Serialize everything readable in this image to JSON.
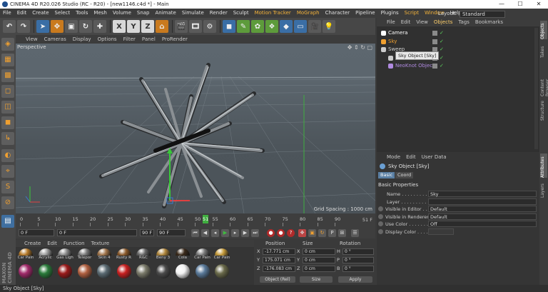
{
  "window": {
    "title": "CINEMA 4D R20.026 Studio (RC - R20) - [new1146.c4d *] - Main",
    "min": "—",
    "max": "☐",
    "close": "✕"
  },
  "menu": [
    "File",
    "Edit",
    "Create",
    "Select",
    "Tools",
    "Mesh",
    "Volume",
    "Snap",
    "Animate",
    "Simulate",
    "Render",
    "Sculpt",
    "Motion Tracker",
    "MoGraph",
    "Character",
    "Pipeline",
    "Plugins",
    "Script",
    "Window",
    "Help"
  ],
  "menu_highlight": [
    "Motion Tracker",
    "MoGraph",
    "Script",
    "Window"
  ],
  "layout": {
    "label": "Layout:",
    "value": "Standard"
  },
  "toolbar_axes": [
    "X",
    "Y",
    "Z"
  ],
  "viewport": {
    "menu": [
      "View",
      "Cameras",
      "Display",
      "Options",
      "Filter",
      "Panel",
      "ProRender"
    ],
    "label": "Perspective",
    "grid_spacing": "Grid Spacing : 1000 cm"
  },
  "timeline": {
    "ticks": [
      "0",
      "5",
      "10",
      "15",
      "20",
      "25",
      "30",
      "35",
      "40",
      "45",
      "50",
      "55",
      "60",
      "65",
      "70",
      "75",
      "80",
      "85",
      "90"
    ],
    "current_frame": "51",
    "end_label": "51 F",
    "start_field": "0 F",
    "min_field": "0 F",
    "max_field": "90 F",
    "end_field": "90 F"
  },
  "materials": {
    "menu": [
      "Create",
      "Edit",
      "Function",
      "Texture"
    ],
    "row1": [
      {
        "label": "Car Pain",
        "color": "#b57a2a"
      },
      {
        "label": "Acrylic",
        "color": "#9a9a9a"
      },
      {
        "label": "Gas Ligh",
        "color": "#8a8a8a"
      },
      {
        "label": "Telepor",
        "color": "#7a7a7a"
      },
      {
        "label": "Skin 4",
        "color": "#a0744a"
      },
      {
        "label": "Rusty R",
        "color": "#8b5a2b"
      },
      {
        "label": "R&C",
        "color": "#666666"
      },
      {
        "label": "Beny 3",
        "color": "#b0873d"
      },
      {
        "label": "Cola",
        "color": "#3a2a1a"
      },
      {
        "label": "Car Pain",
        "color": "#7a7a7a"
      },
      {
        "label": "Car Pain",
        "color": "#c49a3a"
      }
    ],
    "row2": [
      {
        "color": "#a02a6a"
      },
      {
        "color": "#2a7a3a"
      },
      {
        "color": "#9a1a1a"
      },
      {
        "color": "#b06040"
      },
      {
        "color": "#5a6a72"
      },
      {
        "color": "#c82020"
      },
      {
        "color": "#7a7a6a"
      },
      {
        "color": "#4a4a4a"
      },
      {
        "color": "#f2f2f2"
      },
      {
        "color": "#5a7a9a"
      },
      {
        "color": "#6a6a4a"
      }
    ]
  },
  "coords": {
    "headers": [
      "Position",
      "Size",
      "Rotation"
    ],
    "rows": [
      {
        "axis": "X",
        "pos": "-17.771 cm",
        "size": "0 cm",
        "rot_label": "H",
        "rot": "0 °"
      },
      {
        "axis": "Y",
        "pos": "175.071 cm",
        "size": "0 cm",
        "rot_label": "P",
        "rot": "0 °"
      },
      {
        "axis": "Z",
        "pos": "-176.083 cm",
        "size": "0 cm",
        "rot_label": "B",
        "rot": "0 °"
      }
    ],
    "mode": "Object (Rel)",
    "size_mode": "Size",
    "apply": "Apply"
  },
  "objects": {
    "menu": [
      "File",
      "Edit",
      "View",
      "Objects",
      "Tags",
      "Bookmarks"
    ],
    "active_menu": "Objects",
    "items": [
      {
        "name": "Camera",
        "color": "#ffffff"
      },
      {
        "name": "Sky",
        "color": "#f0a030"
      },
      {
        "name": "Sweep",
        "color": "#cccccc"
      },
      {
        "name": "",
        "color": "#cccccc"
      },
      {
        "name": "NeoKnot Object",
        "color": "#b08ae0"
      }
    ],
    "tooltip": "Sky Object [Sky]"
  },
  "attributes": {
    "menu": [
      "Mode",
      "Edit",
      "User Data"
    ],
    "title": "Sky Object [Sky]",
    "tabs": [
      "Basic",
      "Coord"
    ],
    "section": "Basic Properties",
    "props": [
      {
        "label": "Name . . . . . . . . . . .",
        "value": "Sky"
      },
      {
        "label": "Layer . . . . . . . . . . .",
        "value": ""
      },
      {
        "label": "Visible in Editor . .",
        "value": "Default"
      },
      {
        "label": "Visible in Renderer",
        "value": "Default"
      },
      {
        "label": "Use Color . . . . . . .",
        "value": "Off"
      },
      {
        "label": "Display Color . . . .",
        "value": ""
      }
    ]
  },
  "right_tabs": [
    "Objects",
    "Takes",
    "Content Browser",
    "Structure",
    "Attributes",
    "Layers"
  ],
  "status": "Sky Object [Sky]",
  "brand": "MAXON CINEMA 4D"
}
